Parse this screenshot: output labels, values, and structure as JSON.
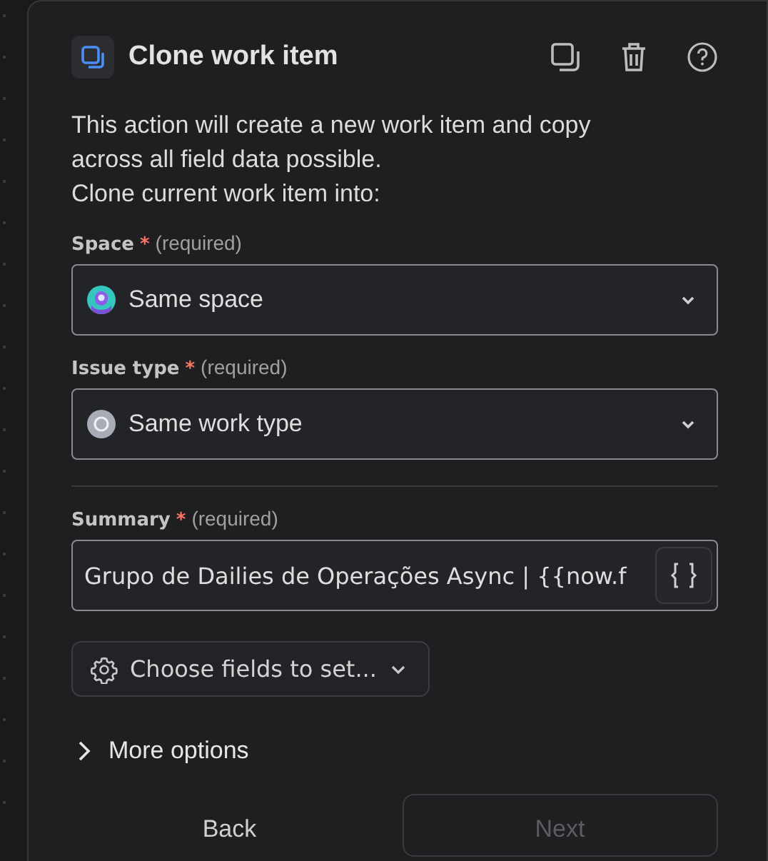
{
  "header": {
    "title": "Clone work item"
  },
  "description": [
    "This action will create a new work item and copy across all field data possible.",
    "Clone current work item into:"
  ],
  "fields": [
    {
      "kind": "select",
      "label": "Space",
      "required_mark": "*",
      "required_note": "(required)",
      "value": "Same space"
    },
    {
      "kind": "select",
      "label": "Issue type",
      "required_mark": "*",
      "required_note": "(required)",
      "value": "Same work type"
    },
    {
      "kind": "divider"
    },
    {
      "kind": "text",
      "label": "Summary",
      "required_mark": "*",
      "required_note": "(required)",
      "value": "Grupo de Dailies de Operações Async | {{now.f"
    }
  ],
  "choose_fields": {
    "label": "Choose fields to set..."
  },
  "more_options": {
    "label": "More options",
    "expanded": false
  },
  "buttons": [
    {
      "label": "Back",
      "kind": "subtle",
      "disabled": false
    },
    {
      "label": "Next",
      "kind": "outline",
      "disabled": true
    }
  ]
}
